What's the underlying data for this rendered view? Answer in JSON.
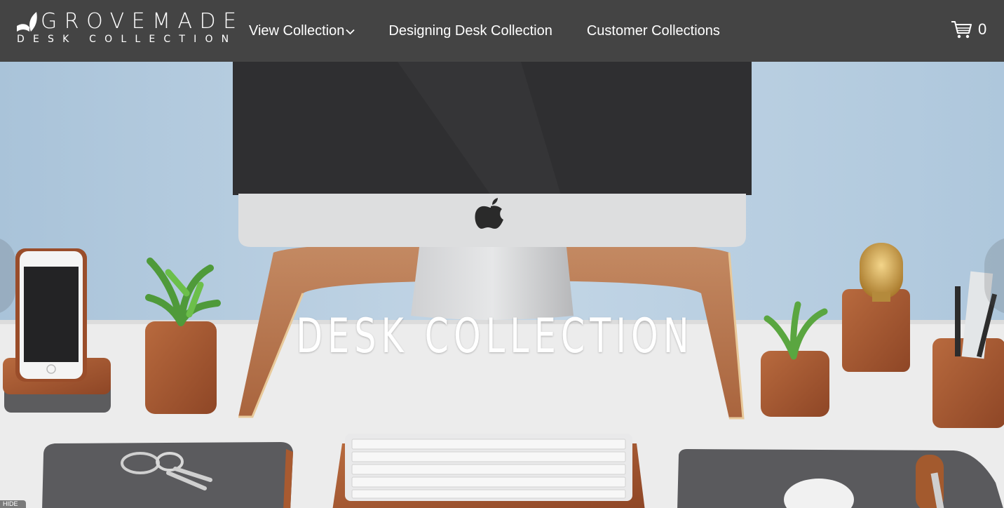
{
  "brand": {
    "name": "GROVEMADE",
    "tagline": "DESK COLLECTION"
  },
  "nav": {
    "items": [
      {
        "label": "View Collection"
      },
      {
        "label": "Designing Desk Collection"
      },
      {
        "label": "Customer Collections"
      }
    ]
  },
  "cart": {
    "count": "0",
    "icon": "shopping-cart-icon"
  },
  "hero": {
    "title": "DESK COLLECTION"
  },
  "overlay": {
    "hide_label": "HIDE"
  },
  "colors": {
    "header_bg": "#444444",
    "wall": "#b9cfe0",
    "desk": "#eeeeee",
    "walnut": "#a3542c"
  }
}
